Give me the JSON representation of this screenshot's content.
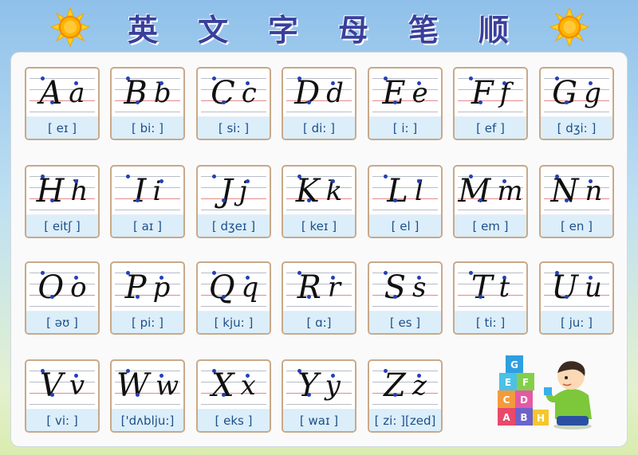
{
  "title": [
    "英",
    "文",
    "字",
    "母",
    "笔",
    "顺"
  ],
  "colors": {
    "title": "#3a3f9b",
    "card_border": "#c8a98a",
    "phonetic_bg": "#dbeef9",
    "phonetic_text": "#1e4f8a"
  },
  "letters": [
    {
      "upper": "A",
      "lower": "a",
      "phonetic": "[ eɪ ]"
    },
    {
      "upper": "B",
      "lower": "b",
      "phonetic": "[ bi: ]"
    },
    {
      "upper": "C",
      "lower": "c",
      "phonetic": "[ si: ]"
    },
    {
      "upper": "D",
      "lower": "d",
      "phonetic": "[ di: ]"
    },
    {
      "upper": "E",
      "lower": "e",
      "phonetic": "[ i: ]"
    },
    {
      "upper": "F",
      "lower": "f",
      "phonetic": "[ ef ]"
    },
    {
      "upper": "G",
      "lower": "g",
      "phonetic": "[ dʒi: ]"
    },
    {
      "upper": "H",
      "lower": "h",
      "phonetic": "[ eitʃ ]"
    },
    {
      "upper": "I",
      "lower": "i",
      "phonetic": "[ aɪ ]"
    },
    {
      "upper": "J",
      "lower": "j",
      "phonetic": "[ dʒeɪ ]"
    },
    {
      "upper": "K",
      "lower": "k",
      "phonetic": "[ keɪ ]"
    },
    {
      "upper": "L",
      "lower": "l",
      "phonetic": "[ el ]"
    },
    {
      "upper": "M",
      "lower": "m",
      "phonetic": "[ em ]"
    },
    {
      "upper": "N",
      "lower": "n",
      "phonetic": "[ en ]"
    },
    {
      "upper": "O",
      "lower": "o",
      "phonetic": "[ əʊ ]"
    },
    {
      "upper": "P",
      "lower": "p",
      "phonetic": "[ pi: ]"
    },
    {
      "upper": "Q",
      "lower": "q",
      "phonetic": "[ kju: ]"
    },
    {
      "upper": "R",
      "lower": "r",
      "phonetic": "[ ɑ:]"
    },
    {
      "upper": "S",
      "lower": "s",
      "phonetic": "[ es ]"
    },
    {
      "upper": "T",
      "lower": "t",
      "phonetic": "[ ti: ]"
    },
    {
      "upper": "U",
      "lower": "u",
      "phonetic": "[ ju: ]"
    },
    {
      "upper": "V",
      "lower": "v",
      "phonetic": "[ vi: ]"
    },
    {
      "upper": "W",
      "lower": "w",
      "phonetic": "['dʌblju:]"
    },
    {
      "upper": "X",
      "lower": "x",
      "phonetic": "[ eks ]"
    },
    {
      "upper": "Y",
      "lower": "y",
      "phonetic": "[ waɪ ]"
    },
    {
      "upper": "Z",
      "lower": "z",
      "phonetic": "[ zi: ][zed]"
    }
  ],
  "illustration": {
    "icons": [
      "sun-icon",
      "child-with-blocks-icon"
    ],
    "block_letters": [
      "A",
      "B",
      "C",
      "D",
      "E",
      "F",
      "G",
      "H"
    ]
  }
}
